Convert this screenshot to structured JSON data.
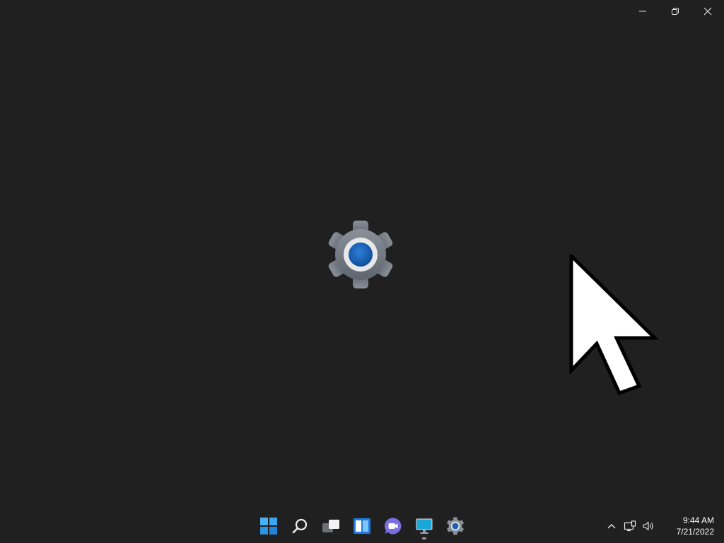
{
  "window": {
    "controls": [
      "minimize",
      "restore",
      "close"
    ]
  },
  "splash": {
    "icon": "settings-gear-icon",
    "accent": "#1b5fb3"
  },
  "taskbar": {
    "apps": [
      {
        "name": "start-button",
        "icon": "windows-logo-icon"
      },
      {
        "name": "search-button",
        "icon": "search-icon"
      },
      {
        "name": "task-view-button",
        "icon": "task-view-icon"
      },
      {
        "name": "widgets-button",
        "icon": "widgets-icon"
      },
      {
        "name": "chat-button",
        "icon": "chat-icon"
      },
      {
        "name": "desktop-app-button",
        "icon": "monitor-icon"
      },
      {
        "name": "settings-app-button",
        "icon": "gear-icon"
      }
    ],
    "tray": {
      "icons": [
        "chevron-up-icon",
        "network-icon",
        "volume-icon"
      ],
      "time": "9:44 AM",
      "date": "7/21/2022"
    }
  },
  "colors": {
    "background": "#202020",
    "start_blue": "#3fa9f5",
    "widgets_blue": "#1c7ad9",
    "chat_purple": "#7b6dd8"
  }
}
